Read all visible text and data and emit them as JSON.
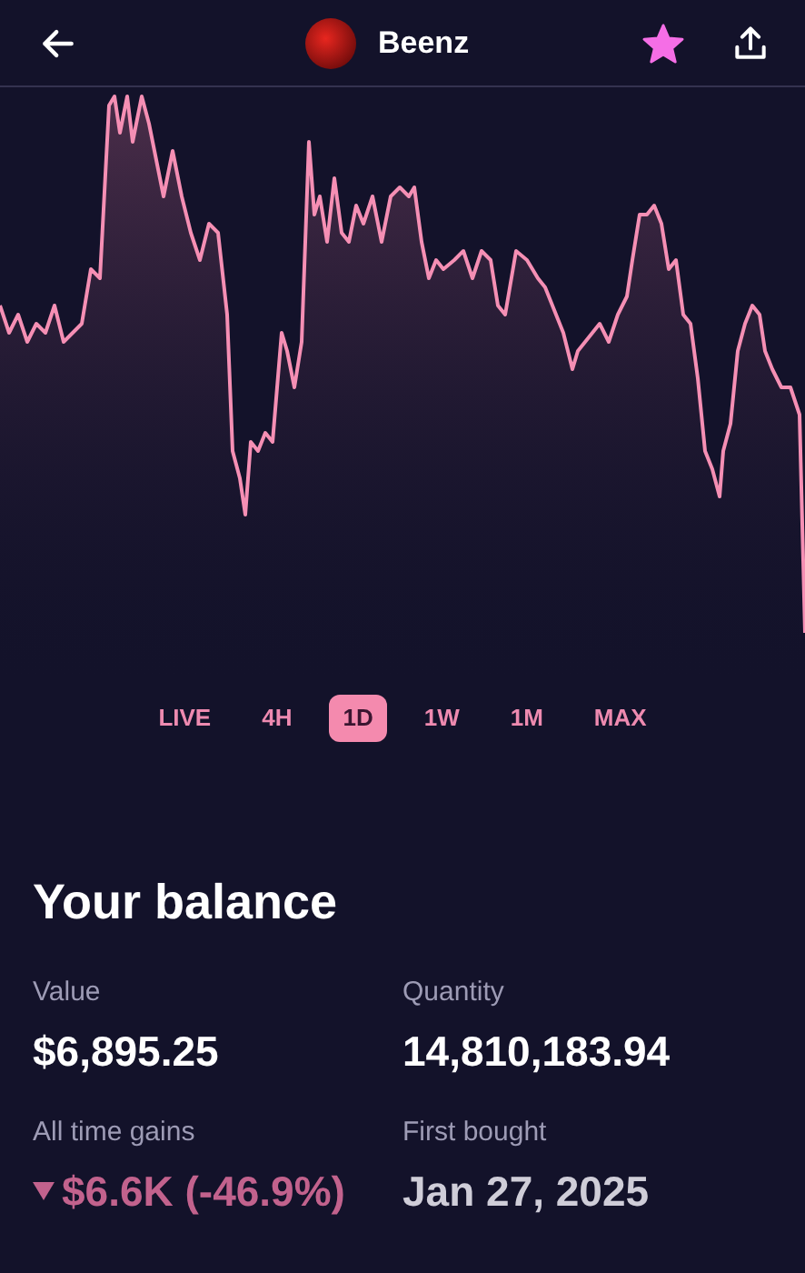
{
  "header": {
    "title": "Beenz",
    "favorite": true
  },
  "ranges": [
    {
      "label": "LIVE",
      "selected": false
    },
    {
      "label": "4H",
      "selected": false
    },
    {
      "label": "1D",
      "selected": true
    },
    {
      "label": "1W",
      "selected": false
    },
    {
      "label": "1M",
      "selected": false
    },
    {
      "label": "MAX",
      "selected": false
    }
  ],
  "balance": {
    "title": "Your balance",
    "stats": [
      {
        "label": "Value",
        "value": "$6,895.25",
        "kind": "plain"
      },
      {
        "label": "Quantity",
        "value": "14,810,183.94",
        "kind": "plain"
      },
      {
        "label": "All time gains",
        "value": "$6.6K (-46.9%)",
        "kind": "change",
        "falling": true
      },
      {
        "label": "First bought",
        "value": "Jan 27, 2025",
        "kind": "muted"
      }
    ]
  }
}
